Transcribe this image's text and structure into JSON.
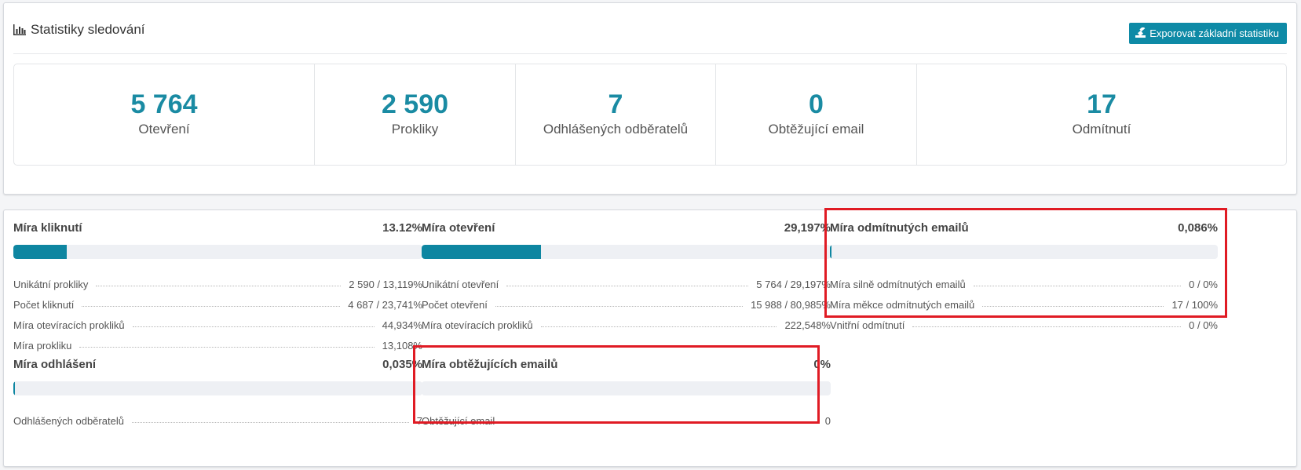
{
  "header": {
    "title": "Statistiky sledování",
    "export_label": "Exporovat základní statistiku"
  },
  "stats": [
    {
      "value": "5 764",
      "label": "Otevření"
    },
    {
      "value": "2 590",
      "label": "Prokliky"
    },
    {
      "value": "7",
      "label": "Odhlášených odběratelů"
    },
    {
      "value": "0",
      "label": "Obtěžující email"
    },
    {
      "value": "17",
      "label": "Odmítnutí"
    }
  ],
  "metrics": {
    "clicks": {
      "title": "Míra kliknutí",
      "value": "13.12%",
      "progress": 0.1312,
      "rows": [
        {
          "label": "Unikátní prokliky",
          "value": "2 590 / 13,119%"
        },
        {
          "label": "Počet kliknutí",
          "value": "4 687 / 23,741%"
        },
        {
          "label": "Míra otevíracích prokliků",
          "value": "44,934%"
        },
        {
          "label": "Míra prokliku",
          "value": "13,108%"
        }
      ]
    },
    "opens": {
      "title": "Míra otevření",
      "value": "29,197%",
      "progress": 0.29197,
      "rows": [
        {
          "label": "Unikátní otevření",
          "value": "5 764 / 29,197%"
        },
        {
          "label": "Počet otevření",
          "value": "15 988 / 80,985%"
        },
        {
          "label": "Míra otevíracích prokliků",
          "value": "222,548%"
        }
      ]
    },
    "bounces": {
      "title": "Míra odmítnutých emailů",
      "value": "0,086%",
      "progress": 0.00086,
      "rows": [
        {
          "label": "Míra silně odmítnutých emailů",
          "value": "0 / 0%"
        },
        {
          "label": "Míra měkce odmítnutých emailů",
          "value": "17 / 100%"
        },
        {
          "label": "Vnitřní odmítnutí",
          "value": "0 / 0%"
        }
      ]
    },
    "unsubscribes": {
      "title": "Míra odhlášení",
      "value": "0,035%",
      "progress": 0.00035,
      "rows": [
        {
          "label": "Odhlášených odběratelů",
          "value": "7"
        }
      ]
    },
    "complaints": {
      "title": "Míra obtěžujících emailů",
      "value": "0%",
      "progress": 0,
      "rows": [
        {
          "label": "Obtěžující email",
          "value": "0"
        }
      ]
    }
  },
  "colors": {
    "accent": "#0e86a1",
    "stat_value": "#1a8ba3",
    "highlight": "#e01b24",
    "progress_track": "#eef0f4"
  }
}
